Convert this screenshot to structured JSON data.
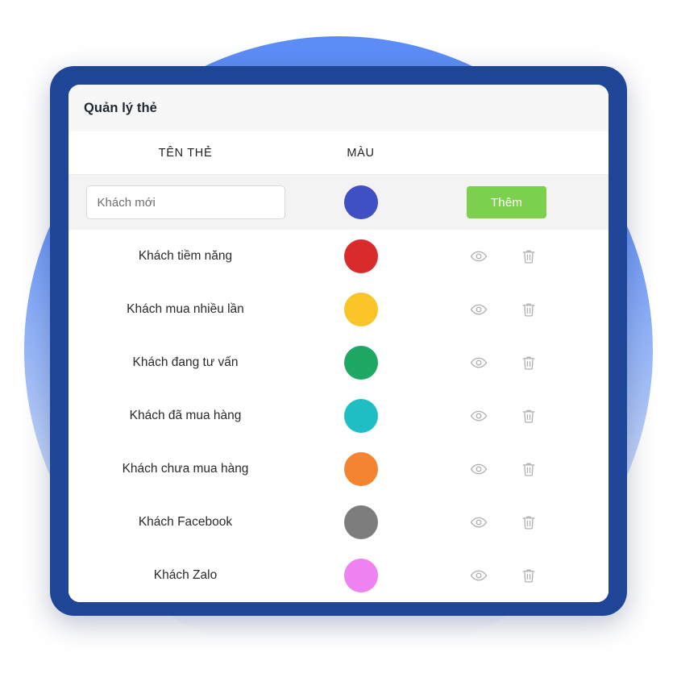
{
  "window": {
    "title": "Quản lý thẻ"
  },
  "table": {
    "headers": {
      "name": "TÊN THẺ",
      "color": "MÀU"
    },
    "add_row": {
      "input_placeholder": "Khách mới",
      "input_value": "",
      "swatch_color": "#3f4fc4",
      "button_label": "Thêm",
      "button_color": "#7dcf4e"
    },
    "rows": [
      {
        "name": "Khách tiềm năng",
        "color": "#d92b2b",
        "view_icon": "eye-icon",
        "delete_icon": "trash-icon"
      },
      {
        "name": "Khách mua nhiều lần",
        "color": "#fbc52a",
        "view_icon": "eye-icon",
        "delete_icon": "trash-icon"
      },
      {
        "name": "Khách đang tư vấn",
        "color": "#1fa864",
        "view_icon": "eye-icon",
        "delete_icon": "trash-icon"
      },
      {
        "name": "Khách đã mua hàng",
        "color": "#1fbec4",
        "view_icon": "eye-icon",
        "delete_icon": "trash-icon"
      },
      {
        "name": "Khách chưa mua hàng",
        "color": "#f48430",
        "view_icon": "eye-icon",
        "delete_icon": "trash-icon"
      },
      {
        "name": "Khách Facebook",
        "color": "#7d7d7d",
        "view_icon": "eye-icon",
        "delete_icon": "trash-icon"
      },
      {
        "name": "Khách Zalo",
        "color": "#ef82f0",
        "view_icon": "eye-icon",
        "delete_icon": "trash-icon"
      }
    ]
  },
  "decoration": {
    "frame_color": "#1e4596",
    "circle_top_color": "#5b8cf5",
    "circle_bottom_color": "#ffffff",
    "titlebar_color": "#f7f7f7",
    "addrow_color": "#f3f3f3"
  }
}
